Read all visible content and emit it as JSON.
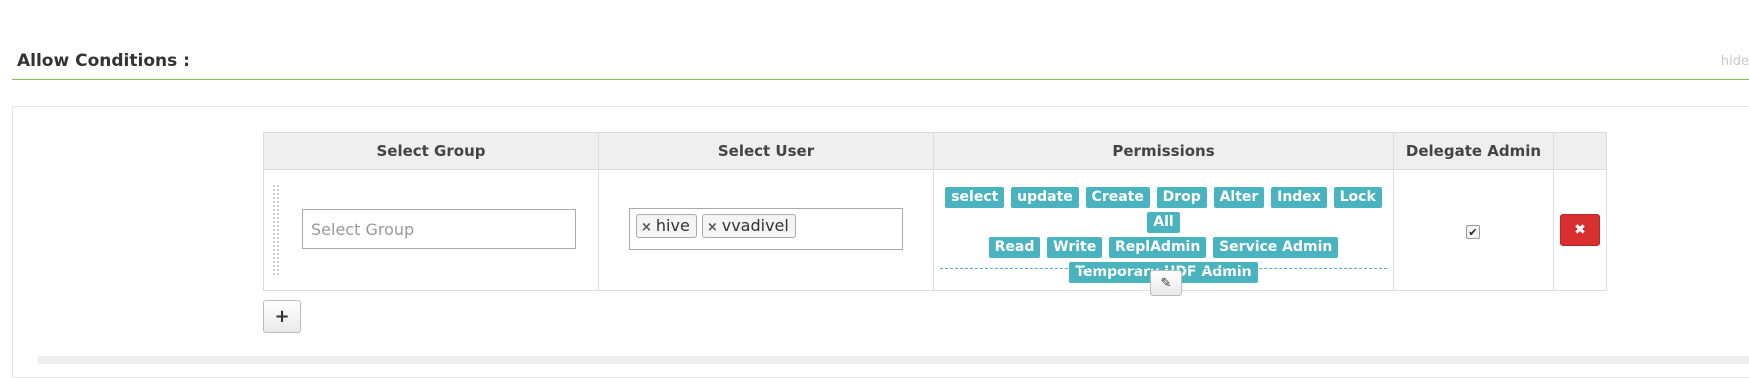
{
  "section": {
    "title": "Allow Conditions :",
    "hide_label": "hide"
  },
  "table": {
    "headers": [
      "Select Group",
      "Select User",
      "Permissions",
      "Delegate Admin",
      ""
    ],
    "row": {
      "group_placeholder": "Select Group",
      "users": [
        "hive",
        "vvadivel"
      ],
      "permissions": [
        "select",
        "update",
        "Create",
        "Drop",
        "Alter",
        "Index",
        "Lock",
        "All",
        "Read",
        "Write",
        "ReplAdmin",
        "Service Admin",
        "Temporary UDF Admin"
      ],
      "delegate_admin_checked": true
    }
  },
  "icons": {
    "remove_tag": "×",
    "checkmark": "✔",
    "pencil": "✎",
    "delete": "✖",
    "add": "+"
  },
  "colors": {
    "accent_line": "#8bc34a",
    "permission_tag": "#4ab3c0",
    "delete_button": "#d9302f"
  }
}
